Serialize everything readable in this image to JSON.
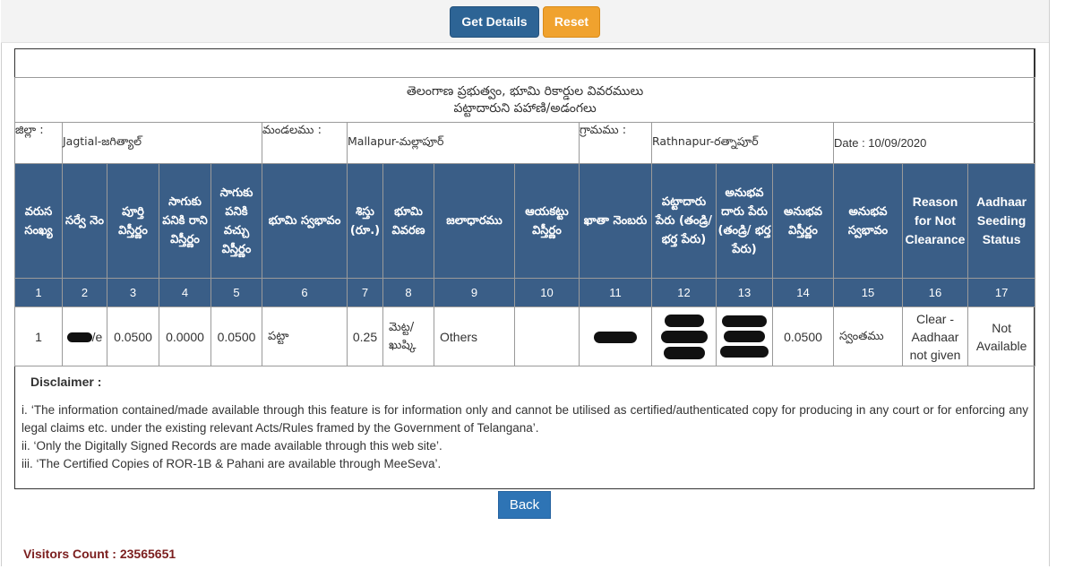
{
  "toolbar": {
    "get_details_label": "Get Details",
    "reset_label": "Reset"
  },
  "report": {
    "title_line1": "తెలంగాణ ప్రభుత్వం, భూమి రికార్డుల వివరములు",
    "title_line2": "పట్టాదారుని పహాణి/అడంగలు"
  },
  "info": {
    "district_label": "జిల్లా :",
    "district_value": "Jagtial-జగిత్యాల్",
    "mandal_label": "మండలము :",
    "mandal_value": "Mallapur-మల్లాపూర్",
    "village_label": "గ్రామము :",
    "village_value": "Rathnapur-రత్నాపూర్",
    "date": "Date : 10/09/2020"
  },
  "columns": [
    {
      "label": "వరుస సంఖ్య",
      "num": "1"
    },
    {
      "label": "సర్వే నెం",
      "num": "2"
    },
    {
      "label": "పూర్తి విస్తీర్ణం",
      "num": "3"
    },
    {
      "label": "సాగుకు పనికి రాని విస్తీర్ణం",
      "num": "4"
    },
    {
      "label": "సాగుకు పనికి వచ్చు విస్తీర్ణం",
      "num": "5"
    },
    {
      "label": "భూమి స్వభావం",
      "num": "6"
    },
    {
      "label": "శిస్తు (రూ.)",
      "num": "7"
    },
    {
      "label": "భూమి వివరణ",
      "num": "8"
    },
    {
      "label": "జలాధారము",
      "num": "9"
    },
    {
      "label": "ఆయకట్టు విస్తీర్ణం",
      "num": "10"
    },
    {
      "label": "ఖాతా నెంబరు",
      "num": "11"
    },
    {
      "label": "పట్టాదారు పేరు (తండ్రి/భర్త పేరు)",
      "num": "12"
    },
    {
      "label": "అనుభవ దారు పేరు (తండ్రి/ భర్త పేరు)",
      "num": "13"
    },
    {
      "label": "అనుభవ విస్తీర్ణం",
      "num": "14"
    },
    {
      "label": "అనుభవ స్వభావం",
      "num": "15"
    },
    {
      "label": "Reason for Not Clearance",
      "num": "16"
    },
    {
      "label": "Aadhaar Seeding Status",
      "num": "17"
    }
  ],
  "row": {
    "serial": "1",
    "survey_suffix": "/e",
    "total_extent": "0.0500",
    "uncultivable_extent": "0.0000",
    "cultivable_extent": "0.0500",
    "land_nature": "పట్టా",
    "tax": "0.25",
    "land_classification": "మెట్ట/ ఖుష్కి",
    "water_source": "Others",
    "ayacut_extent": "",
    "enjoyment_extent": "0.0500",
    "enjoyment_nature": "స్వంతము",
    "reason": "Clear - Aadhaar not given",
    "aadhaar_status": "Not Available"
  },
  "disclaimer": {
    "title": "Disclaimer :",
    "line1": "i. ‘The information contained/made available through this feature is for information only and cannot be utilised as certified/authenticated copy for producing in any court or for enforcing any legal claims etc. under the existing relevant Acts/Rules framed by the Government of Telangana’.",
    "line2": "ii. ‘Only the Digitally Signed Records are made available through this web site’.",
    "line3": "iii. ‘The Certified Copies of ROR-1B & Pahani are available through MeeSeva’."
  },
  "back_label": "Back",
  "visitors": "Visitors Count : 23565651"
}
